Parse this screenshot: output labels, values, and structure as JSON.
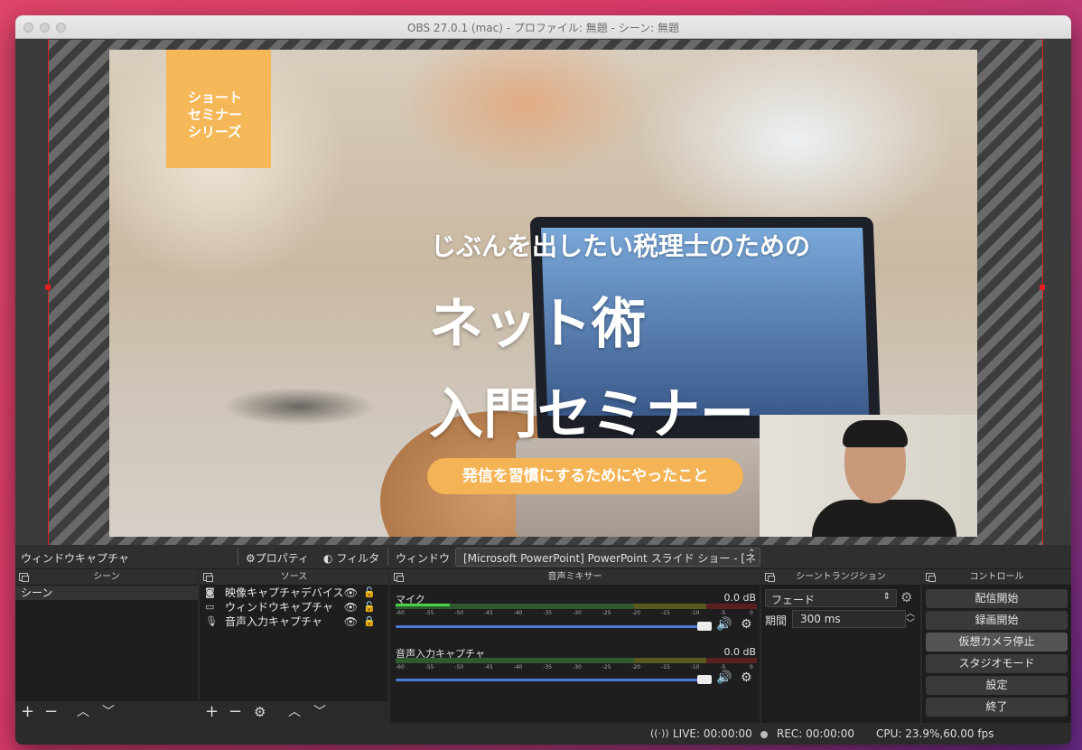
{
  "window": {
    "title": "OBS 27.0.1 (mac) - プロファイル: 無題 - シーン: 無題"
  },
  "slide": {
    "badge_lines": [
      "ショート",
      "セミナー",
      "シリーズ"
    ],
    "headline1": "じぶんを出したい税理士のための",
    "headline2": "ネット術",
    "headline3": "入門セミナー",
    "pill": "発信を習慣にするためにやったこと"
  },
  "toolbar": {
    "source_name": "ウィンドウキャプチャ",
    "properties_label": "プロパティ",
    "filters_label": "フィルタ",
    "window_label": "ウィンドウ",
    "window_value": "[Microsoft PowerPoint] PowerPoint スライド ショー - [ネ"
  },
  "docks": {
    "scenes": {
      "title": "シーン",
      "items": [
        "シーン"
      ]
    },
    "sources": {
      "title": "ソース",
      "items": [
        {
          "label": "映像キャプチャデバイス",
          "icon": "camera-icon"
        },
        {
          "label": "ウィンドウキャプチャ",
          "icon": "window-icon"
        },
        {
          "label": "音声入力キャプチャ",
          "icon": "mic-icon"
        }
      ]
    },
    "mixer": {
      "title": "音声ミキサー",
      "channels": [
        {
          "name": "マイク",
          "db": "0.0 dB",
          "level": 0.15
        },
        {
          "name": "音声入力キャプチャ",
          "db": "0.0 dB",
          "level": 0.0
        }
      ],
      "ticks": [
        "-60",
        "-55",
        "-50",
        "-45",
        "-40",
        "-35",
        "-30",
        "-25",
        "-20",
        "-15",
        "-10",
        "-5",
        "0"
      ]
    },
    "transitions": {
      "title": "シーントランジション",
      "selected": "フェード",
      "duration_label": "期間",
      "duration_value": "300 ms"
    },
    "controls": {
      "title": "コントロール",
      "buttons": [
        "配信開始",
        "録画開始",
        "仮想カメラ停止",
        "スタジオモード",
        "設定",
        "終了"
      ]
    }
  },
  "status": {
    "live": "LIVE: 00:00:00",
    "rec": "REC: 00:00:00",
    "cpu": "CPU: 23.9%,60.00 fps"
  }
}
